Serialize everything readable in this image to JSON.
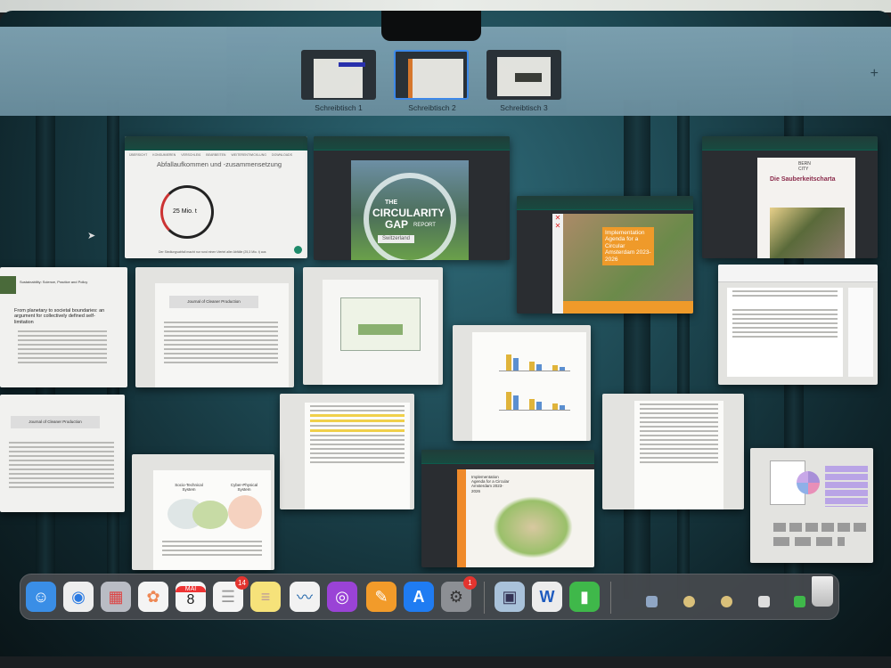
{
  "spaces": [
    {
      "label": "Schreibtisch 1"
    },
    {
      "label": "Schreibtisch 2",
      "active": true
    },
    {
      "label": "Schreibtisch 3"
    }
  ],
  "add_space": "+",
  "windows": {
    "waste": {
      "nav": [
        "ÜBERSICHT",
        "KONSUMIEREN",
        "VERSCHLEIß",
        "BEARBEITEN",
        "WEITERENTWICKLUNG",
        "DOWNLOADS"
      ],
      "title": "Abfallaufkommen und -zusammensetzung",
      "center": "25 Mio. t",
      "footer": "Der Siedlungsabfall macht nur rund einen Viertel aller Abfälle (25,3 Mio. t) aus"
    },
    "circularity": {
      "l1": "THE",
      "l2": "CIRCULARITY",
      "l3": "GAP",
      "l4": "REPORT",
      "country": "Switzerland"
    },
    "bern": {
      "logo": "BERN CITY",
      "title": "Die Sauberkeitscharta"
    },
    "amsterdam": {
      "title": "Implementation Agenda for a Circular Amsterdam 2023-2026"
    },
    "sustainability": {
      "journal": "Sustainability: Science, Practice and Policy",
      "title": "From planetary to societal boundaries: an argument for collectively defined self-limitation"
    },
    "jcp1": {
      "journal": "Journal of Cleaner Production"
    },
    "jcp2": {
      "journal": "Journal of Cleaner Production"
    },
    "diagram": {
      "left": "Socio-Technical System",
      "right": "Cyber-Physical System"
    },
    "amsterdam2": {
      "title": "Implementation Agenda for a Circular Amsterdam 2023-2026"
    }
  },
  "dock": {
    "apps": [
      {
        "name": "Finder",
        "icon": "finder-icon",
        "color": "#3a8ee6",
        "glyph": "☺"
      },
      {
        "name": "Google Chrome",
        "icon": "chrome-icon",
        "color": "#eeeeee",
        "glyph": "◉"
      },
      {
        "name": "Launchpad",
        "icon": "launchpad-icon",
        "color": "#b9bcc4",
        "glyph": "▦"
      },
      {
        "name": "Photos",
        "icon": "photos-icon",
        "color": "#f4f4f4",
        "glyph": "✿"
      },
      {
        "name": "Calendar",
        "icon": "calendar-icon",
        "color": "#f6f6f6",
        "month": "MAI",
        "day": "8"
      },
      {
        "name": "Reminders",
        "icon": "reminders-icon",
        "color": "#f4f4f4",
        "glyph": "☰",
        "badge": "14"
      },
      {
        "name": "Notes",
        "icon": "notes-icon",
        "color": "#f6e27a",
        "glyph": "≡"
      },
      {
        "name": "Freeform",
        "icon": "freeform-icon",
        "color": "#f2f2f2",
        "glyph": "〰"
      },
      {
        "name": "Podcasts",
        "icon": "podcasts-icon",
        "color": "#9a43d6",
        "glyph": "◎"
      },
      {
        "name": "Pages",
        "icon": "pages-icon",
        "color": "#f29b2a",
        "glyph": "✎"
      },
      {
        "name": "App Store",
        "icon": "app-store-icon",
        "color": "#1f7cf2",
        "glyph": "A"
      },
      {
        "name": "System Settings",
        "icon": "settings-icon",
        "color": "#8c8f94",
        "glyph": "⚙",
        "badge": "1"
      },
      {
        "name": "Preview",
        "icon": "preview-icon",
        "color": "#a9c2da",
        "glyph": "▣"
      },
      {
        "name": "Microsoft Word",
        "icon": "word-icon",
        "color": "#ececec",
        "glyph": "W"
      },
      {
        "name": "Numbers",
        "icon": "numbers-icon",
        "color": "#3fb84a",
        "glyph": "▮"
      }
    ],
    "minimized": [
      {
        "icon": "preview-icon",
        "color": "#8fa6c4"
      },
      {
        "icon": "chrome-icon",
        "color": "#d9c07a"
      },
      {
        "icon": "chrome-icon",
        "color": "#d9c07a"
      },
      {
        "icon": "reminders-icon",
        "color": "#dddddd"
      },
      {
        "icon": "numbers-icon",
        "color": "#3fb84a"
      }
    ],
    "trash": "trash-icon"
  }
}
